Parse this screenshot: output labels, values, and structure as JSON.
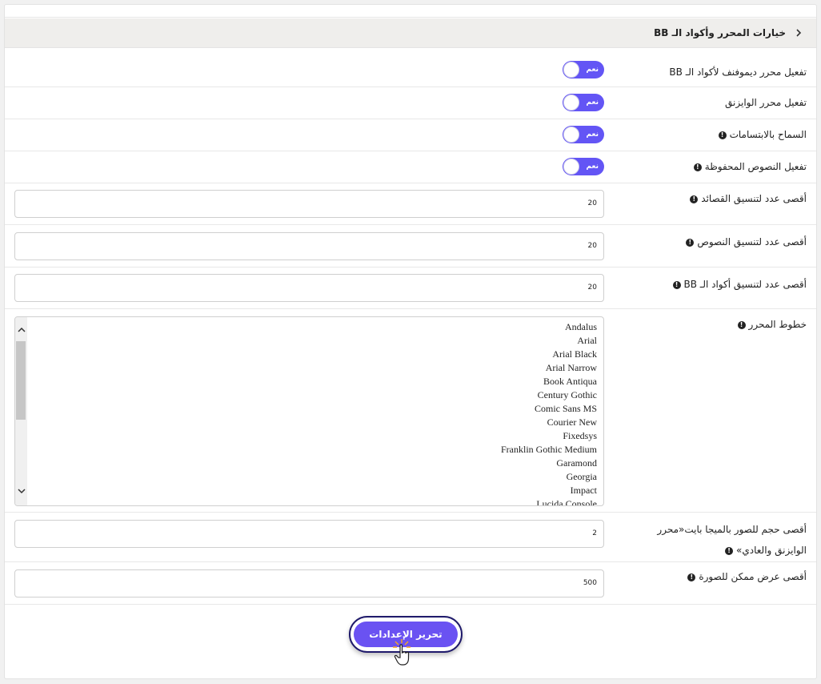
{
  "section": {
    "title": "خيارات المحرر وأكواد الـ BB"
  },
  "toggle_label": "نعم",
  "info_glyph": "!",
  "rows": {
    "demofnf": "تفعيل محرر ديموفنف لأكواد الـ BB",
    "wysiwyg": "تفعيل محرر الوايزنق",
    "smilies": "السماح بالابتسامات",
    "saved_text": "تفعيل النصوص المحفوظة",
    "max_poems": "أقصى عدد لتنسيق القصائد",
    "max_texts": "أقصى عدد لتنسيق النصوص",
    "max_bb": "أقصى عدد لتنسيق أكواد الـ BB",
    "fonts": "خطوط المحرر",
    "max_img_size": "أقصى حجم للصور بالميجا بايت«محرر الوايزنق والعادي»",
    "max_img_width": "أقصى عرض ممكن للصورة"
  },
  "values": {
    "max_poems": "20",
    "max_texts": "20",
    "max_bb": "20",
    "max_img_size": "2",
    "max_img_width": "500"
  },
  "fonts": [
    "Andalus",
    "Arial",
    "Arial Black",
    "Arial Narrow",
    "Book Antiqua",
    "Century Gothic",
    "Comic Sans MS",
    "Courier New",
    "Fixedsys",
    "Franklin Gothic Medium",
    "Garamond",
    "Georgia",
    "Impact",
    "Lucida Console"
  ],
  "submit_label": "تحرير الإعدادات",
  "colors": {
    "accent": "#6355f5",
    "button_border": "#1f1a6b"
  }
}
